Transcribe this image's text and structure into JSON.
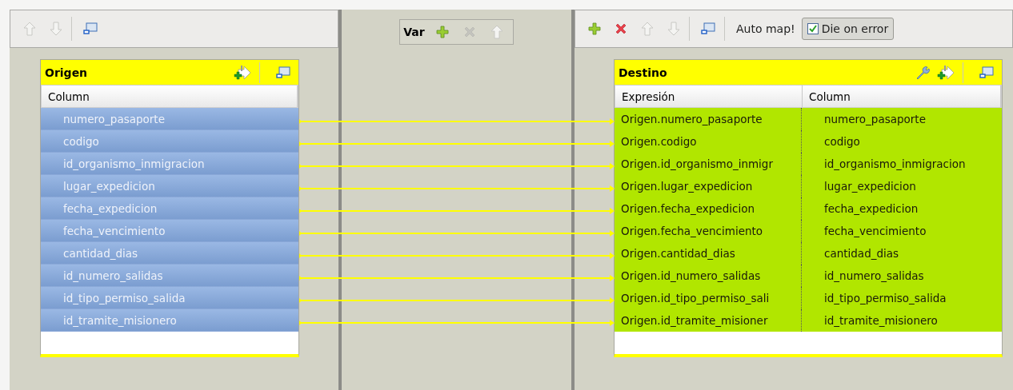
{
  "left_toolbar": {
    "buttons": [
      {
        "kind": "up",
        "disabled": true
      },
      {
        "kind": "down",
        "disabled": true
      },
      {
        "kind": "separator"
      },
      {
        "kind": "layout",
        "disabled": false
      }
    ]
  },
  "source_table": {
    "title": "Origen",
    "header_buttons": [
      {
        "kind": "add-arrow"
      },
      {
        "kind": "separator"
      },
      {
        "kind": "layout"
      }
    ],
    "columns": [
      "Column"
    ],
    "rows": [
      {
        "name": "numero_pasaporte",
        "selected": true
      },
      {
        "name": "codigo",
        "selected": true
      },
      {
        "name": "id_organismo_inmigracion",
        "selected": true
      },
      {
        "name": "lugar_expedicion",
        "selected": true
      },
      {
        "name": "fecha_expedicion",
        "selected": true
      },
      {
        "name": "fecha_vencimiento",
        "selected": true
      },
      {
        "name": "cantidad_dias",
        "selected": true
      },
      {
        "name": "id_numero_salidas",
        "selected": true
      },
      {
        "name": "id_tipo_permiso_salida",
        "selected": true
      },
      {
        "name": "id_tramite_misionero",
        "selected": true
      }
    ]
  },
  "variables": {
    "title": "Var",
    "buttons": [
      {
        "kind": "add",
        "disabled": false
      },
      {
        "kind": "delete",
        "disabled": true
      },
      {
        "kind": "up",
        "disabled": true
      }
    ]
  },
  "right_toolbar": {
    "buttons": [
      {
        "kind": "add",
        "disabled": false
      },
      {
        "kind": "delete",
        "disabled": false
      },
      {
        "kind": "up",
        "disabled": true
      },
      {
        "kind": "down",
        "disabled": true
      },
      {
        "kind": "separator"
      },
      {
        "kind": "layout",
        "disabled": false
      },
      {
        "kind": "separator"
      }
    ],
    "auto_map": "Auto map!",
    "die_on_error": {
      "label": "Die on error",
      "checked": true
    }
  },
  "target_table": {
    "title": "Destino",
    "header_buttons": [
      {
        "kind": "wrench"
      },
      {
        "kind": "add-arrow"
      },
      {
        "kind": "separator"
      },
      {
        "kind": "layout"
      }
    ],
    "columns": [
      "Expresión",
      "Column"
    ],
    "rows": [
      {
        "expression": "Origen.numero_pasaporte",
        "column": "numero_pasaporte",
        "mapped": true
      },
      {
        "expression": "Origen.codigo",
        "column": "codigo",
        "mapped": true
      },
      {
        "expression": "Origen.id_organismo_inmigr",
        "column": "id_organismo_inmigracion",
        "mapped": true
      },
      {
        "expression": "Origen.lugar_expedicion",
        "column": "lugar_expedicion",
        "mapped": true
      },
      {
        "expression": "Origen.fecha_expedicion",
        "column": "fecha_expedicion",
        "mapped": true
      },
      {
        "expression": "Origen.fecha_vencimiento",
        "column": "fecha_vencimiento",
        "mapped": true
      },
      {
        "expression": "Origen.cantidad_dias",
        "column": "cantidad_dias",
        "mapped": true
      },
      {
        "expression": "Origen.id_numero_salidas",
        "column": "id_numero_salidas",
        "mapped": true
      },
      {
        "expression": "Origen.id_tipo_permiso_sali",
        "column": "id_tipo_permiso_salida",
        "mapped": true
      },
      {
        "expression": "Origen.id_tramite_misioner",
        "column": "id_tramite_misionero",
        "mapped": true
      }
    ]
  }
}
